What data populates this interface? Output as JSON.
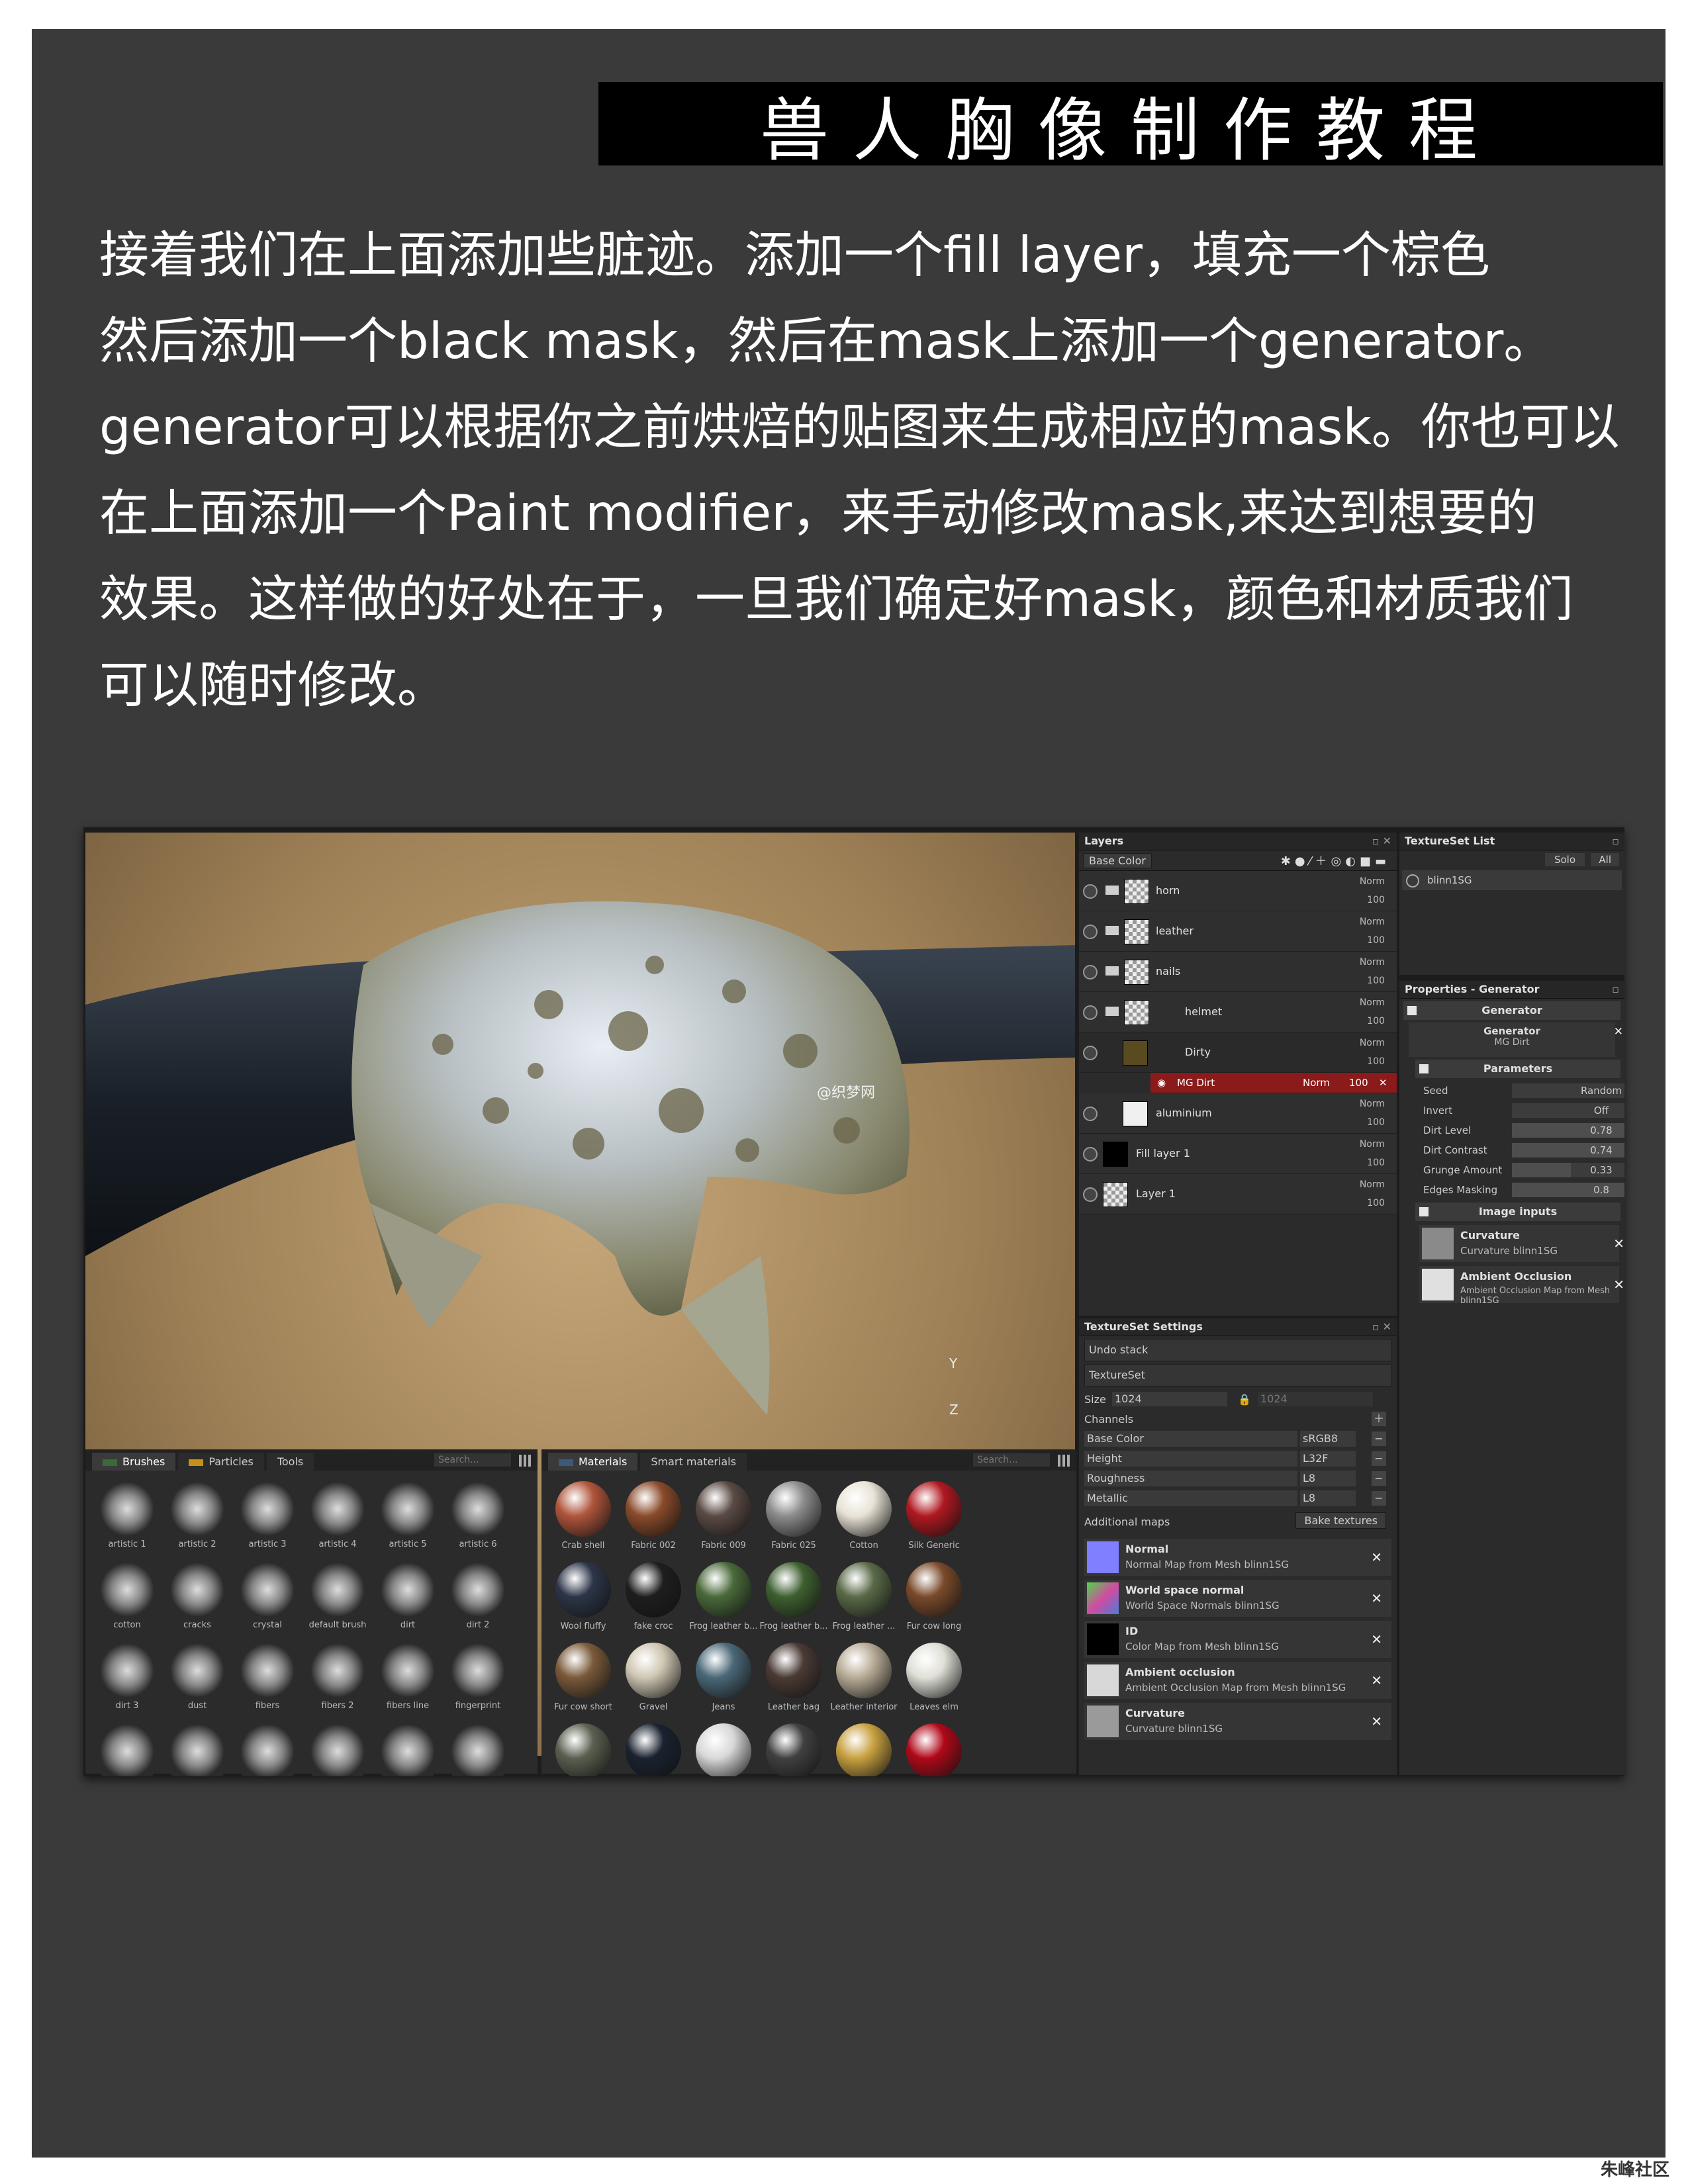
{
  "title": "兽人胸像制作教程",
  "paragraph_lines": [
    "接着我们在上面添加些脏迹。添加一个fill layer，填充一个棕色",
    "然后添加一个black mask，然后在mask上添加一个generator。",
    "generator可以根据你之前烘焙的贴图来生成相应的mask。你也可以",
    "在上面添加一个Paint modifier，来手动修改mask,来达到想要的",
    "效果。这样做的好处在于，一旦我们确定好mask，颜色和材质我们",
    "可以随时修改。"
  ],
  "viewport": {
    "watermark": "@织梦网",
    "axis_y": "Y",
    "axis_z": "Z"
  },
  "layers": {
    "header": "Layers",
    "channel_dropdown": "Base Color",
    "rows": [
      {
        "name": "horn",
        "blend": "Norm",
        "opacity": "100"
      },
      {
        "name": "leather",
        "blend": "Norm",
        "opacity": "100"
      },
      {
        "name": "nails",
        "blend": "Norm",
        "opacity": "100"
      },
      {
        "name": "helmet",
        "blend": "Norm",
        "opacity": "100"
      },
      {
        "name": "Dirty",
        "blend": "Norm",
        "opacity": "100"
      },
      {
        "name": "aluminium",
        "blend": "Norm",
        "opacity": "100"
      },
      {
        "name": "Fill layer 1",
        "blend": "Norm",
        "opacity": "100"
      },
      {
        "name": "Layer 1",
        "blend": "Norm",
        "opacity": "100"
      }
    ],
    "generator_row": {
      "name": "MG Dirt",
      "blend": "Norm",
      "opacity": "100"
    }
  },
  "textureset_list": {
    "header": "TextureSet List",
    "solo": "Solo",
    "all": "All",
    "item": "blinn1SG"
  },
  "properties": {
    "header": "Properties - Generator",
    "generator_section": "Generator",
    "generator_label": "Generator",
    "generator_value": "MG Dirt",
    "parameters_section": "Parameters",
    "params": [
      {
        "label": "Seed",
        "value": "Random",
        "level": 0
      },
      {
        "label": "Invert",
        "value": "Off",
        "level": 0
      },
      {
        "label": "Dirt Level",
        "value": "0.78",
        "level": 0.78
      },
      {
        "label": "Dirt Contrast",
        "value": "0.74",
        "level": 0.74
      },
      {
        "label": "Grunge Amount",
        "value": "0.33",
        "level": 0.33
      },
      {
        "label": "Edges Masking",
        "value": "0.8",
        "level": 0.8
      }
    ],
    "image_inputs_section": "Image inputs",
    "inputs": [
      {
        "title": "Curvature",
        "sub": "Curvature blinn1SG"
      },
      {
        "title": "Ambient Occlusion",
        "sub": "Ambient Occlusion Map from Mesh blinn1SG"
      }
    ]
  },
  "textureset_settings": {
    "header": "TextureSet Settings",
    "undo_stack": "Undo stack",
    "textureset": "TextureSet",
    "size_label": "Size",
    "size_value": "1024",
    "size_value2": "1024",
    "channels_label": "Channels",
    "channels": [
      {
        "name": "Base Color",
        "format": "sRGB8"
      },
      {
        "name": "Height",
        "format": "L32F"
      },
      {
        "name": "Roughness",
        "format": "L8"
      },
      {
        "name": "Metallic",
        "format": "L8"
      }
    ],
    "additional_maps": "Additional maps",
    "bake_button": "Bake textures",
    "maps": [
      {
        "title": "Normal",
        "sub": "Normal Map from Mesh blinn1SG",
        "color": "#7f7fff"
      },
      {
        "title": "World space normal",
        "sub": "World Space Normals blinn1SG",
        "color": "#a05cc8"
      },
      {
        "title": "ID",
        "sub": "Color Map from Mesh blinn1SG",
        "color": "#000000"
      },
      {
        "title": "Ambient occlusion",
        "sub": "Ambient Occlusion Map from Mesh blinn1SG",
        "color": "#d8d8d8"
      },
      {
        "title": "Curvature",
        "sub": "Curvature blinn1SG",
        "color": "#9a9a9a"
      }
    ]
  },
  "shelf_left": {
    "tabs": [
      "Brushes",
      "Particles",
      "Tools"
    ],
    "search_placeholder": "Search...",
    "items": [
      "artistic 1",
      "artistic 2",
      "artistic 3",
      "artistic 4",
      "artistic 5",
      "artistic 6",
      "cotton",
      "cracks",
      "crystal",
      "default brush",
      "dirt",
      "dirt 2",
      "dirt 3",
      "dust",
      "fibers",
      "fibers 2",
      "fibers line",
      "fingerprint",
      "",
      "",
      "",
      "",
      "",
      ""
    ]
  },
  "shelf_right": {
    "tabs": [
      "Materials",
      "Smart materials"
    ],
    "search_placeholder": "Search...",
    "items": [
      {
        "name": "Crab shell",
        "color": "#b0553c"
      },
      {
        "name": "Fabric 002",
        "color": "#8a4a2a"
      },
      {
        "name": "Fabric 009",
        "color": "#5a4a44"
      },
      {
        "name": "Fabric 025",
        "color": "#8c8c8c"
      },
      {
        "name": "Cotton",
        "color": "#e8e3d6"
      },
      {
        "name": "Silk Generic",
        "color": "#b01820"
      },
      {
        "name": "Wool fluffy",
        "color": "#2c3548"
      },
      {
        "name": "fake croc",
        "color": "#1e1e1e"
      },
      {
        "name": "Frog leather b...",
        "color": "#4a6a3a"
      },
      {
        "name": "Frog leather b...",
        "color": "#3e6030"
      },
      {
        "name": "Frog leather ...",
        "color": "#5a6a48"
      },
      {
        "name": "Fur cow long",
        "color": "#7a4a2a"
      },
      {
        "name": "Fur cow short",
        "color": "#7a5a3a"
      },
      {
        "name": "Gravel",
        "color": "#cfc7b3"
      },
      {
        "name": "Jeans",
        "color": "#4a6878"
      },
      {
        "name": "Leather bag",
        "color": "#4a3a34"
      },
      {
        "name": "Leather interior",
        "color": "#b8ac96"
      },
      {
        "name": "Leaves elm",
        "color": "#e0e0d8"
      },
      {
        "name": "",
        "color": "#5a6050"
      },
      {
        "name": "",
        "color": "#1a2230"
      },
      {
        "name": "",
        "color": "#d8d8d8"
      },
      {
        "name": "",
        "color": "#404040"
      },
      {
        "name": "",
        "color": "#c8a040"
      },
      {
        "name": "",
        "color": "#b00818"
      }
    ]
  },
  "logo": "朱峰社区"
}
